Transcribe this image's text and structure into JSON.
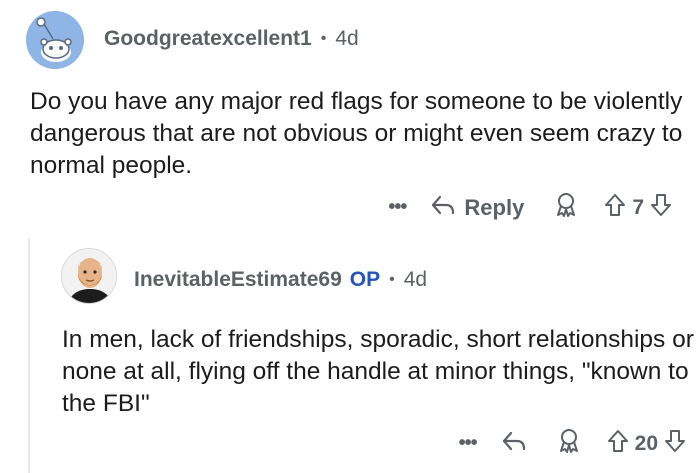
{
  "comments": [
    {
      "author": "Goodgreatexcellent1",
      "age": "4d",
      "body": "Do you have any major red flags for someone to be violently dangerous that are not obvious or might even seem crazy to normal people.",
      "reply_label": "Reply",
      "score": "7"
    },
    {
      "author": "InevitableEstimate69",
      "op_badge": "OP",
      "age": "4d",
      "body": "In men, lack of friendships, sporadic, short relationships or none at all, flying off the handle at minor things, \"known to the FBI\"",
      "score": "20"
    }
  ],
  "separator": "•",
  "more_label": "•••",
  "icons": {
    "avatar1": "snoo-avatar-icon",
    "avatar2": "bearded-man-avatar-icon",
    "reply": "reply-arrow-icon",
    "award": "award-icon",
    "upvote": "upvote-arrow-icon",
    "downvote": "downvote-arrow-icon"
  },
  "colors": {
    "op_badge": "#2455b8",
    "meta_text": "#5c6166",
    "body_text": "#1c1c1c",
    "avatar1_bg": "#8fb5e6"
  }
}
